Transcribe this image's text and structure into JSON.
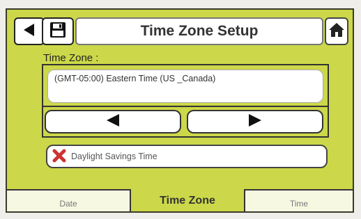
{
  "header": {
    "title": "Time Zone Setup",
    "icons": {
      "back": "back-arrow-icon",
      "save": "floppy-disk-icon",
      "home": "home-icon"
    }
  },
  "time_zone": {
    "label": "Time Zone :",
    "value": "(GMT-05:00) Eastern Time (US _Canada)",
    "prev_icon": "left-triangle-icon",
    "next_icon": "right-triangle-icon"
  },
  "dst": {
    "label": "Daylight Savings Time",
    "checked": false,
    "state_icon": "red-x-icon"
  },
  "tabs": [
    {
      "label": "Date",
      "active": false
    },
    {
      "label": "Time Zone",
      "active": true
    },
    {
      "label": "Time",
      "active": false
    }
  ],
  "colors": {
    "screen_bg": "#ccd849",
    "tab_bg": "#f7f8e2",
    "x_red": "#cc3333"
  }
}
